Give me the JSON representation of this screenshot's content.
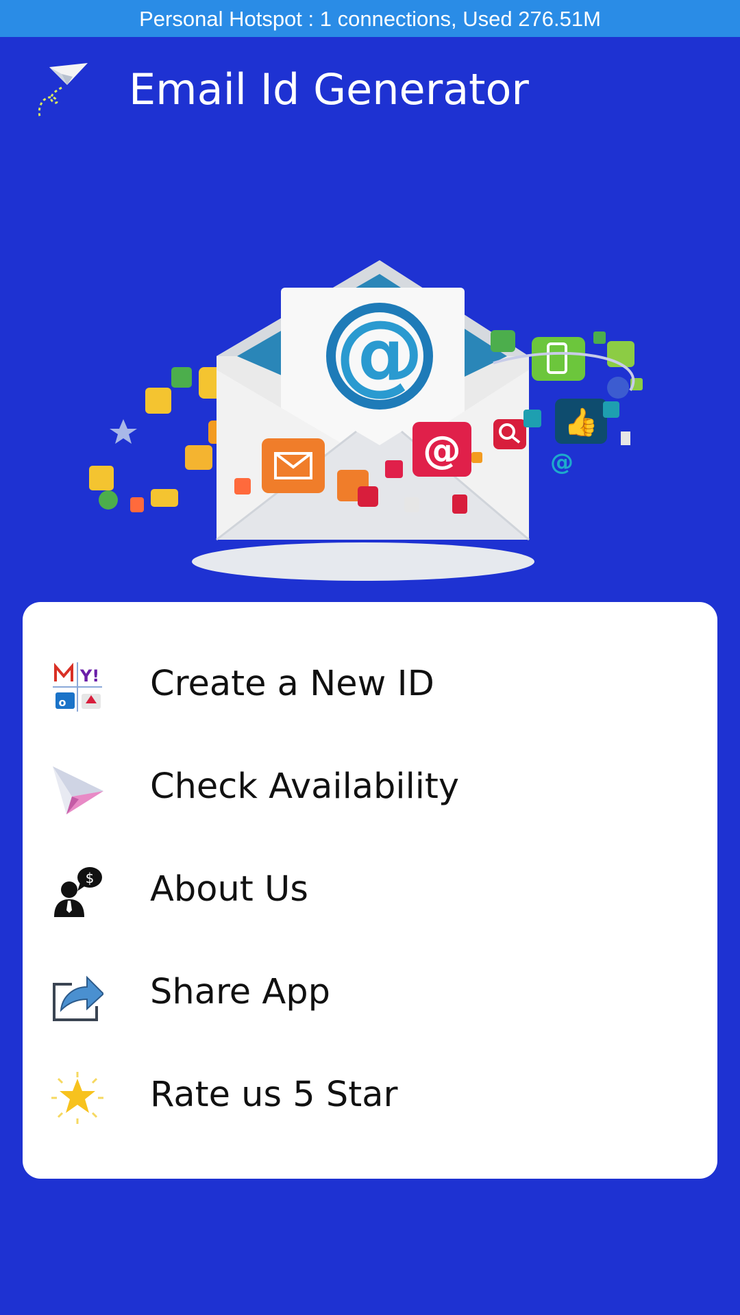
{
  "status_bar": {
    "text": "Personal Hotspot : 1 connections, Used 276.51M"
  },
  "header": {
    "title": "Email Id Generator",
    "logo_icon": "paper-plane-icon"
  },
  "hero": {
    "icon": "email-envelope-illustration"
  },
  "menu": {
    "items": [
      {
        "label": "Create  a New ID",
        "icon": "mail-providers-icon"
      },
      {
        "label": "Check Availability",
        "icon": "paper-plane-pink-icon"
      },
      {
        "label": "About Us",
        "icon": "business-person-icon"
      },
      {
        "label": "Share App",
        "icon": "share-arrow-icon"
      },
      {
        "label": "Rate us 5 Star",
        "icon": "star-icon"
      }
    ]
  },
  "colors": {
    "background": "#1e32d2",
    "status_bar": "#2a8ce6",
    "card": "#ffffff",
    "text_dark": "#111111"
  }
}
